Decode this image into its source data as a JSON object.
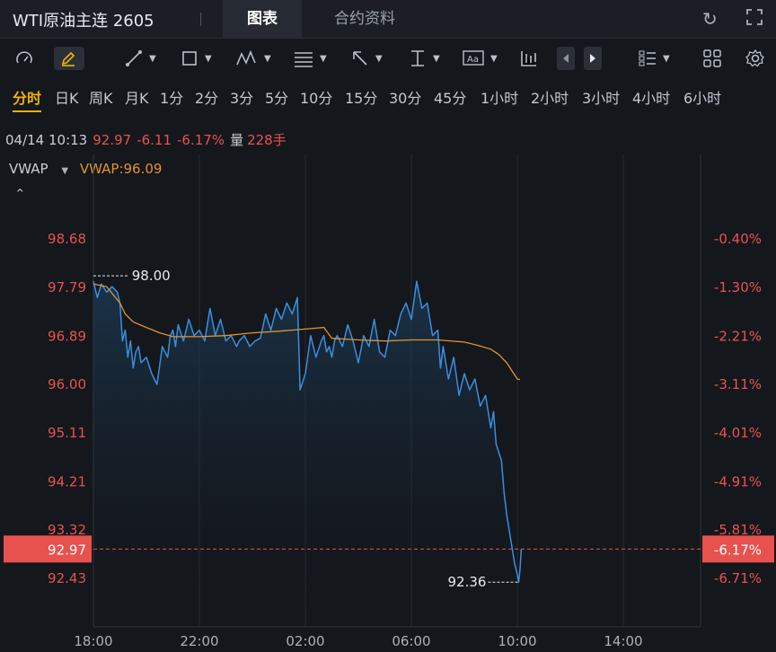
{
  "header": {
    "title": "WTI原油主连 2605",
    "tabs": [
      {
        "label": "图表",
        "active": true
      },
      {
        "label": "合约资料",
        "active": false
      }
    ],
    "icons": [
      "refresh-icon",
      "fullscreen-icon"
    ]
  },
  "toolbar": {
    "tools": [
      "gauge-icon",
      "pen-icon",
      "trendline-icon",
      "rectangle-icon",
      "wave-icon",
      "fib-icon",
      "arrow-icon",
      "measure-icon",
      "text-icon",
      "candles-icon",
      "prev-icon",
      "next-icon",
      "list-icon",
      "grid-icon",
      "settings-icon"
    ]
  },
  "periods": [
    "分时",
    "日K",
    "周K",
    "月K",
    "1分",
    "2分",
    "3分",
    "5分",
    "10分",
    "15分",
    "30分",
    "45分",
    "1小时",
    "2小时",
    "3小时",
    "4小时",
    "6小时"
  ],
  "info": {
    "datetime": "04/14 10:13",
    "price": "92.97",
    "change": "-6.11",
    "change_pct": "-6.17%",
    "volume_label": "量",
    "volume": "228手"
  },
  "indicator": {
    "name": "VWAP",
    "value_label": "VWAP:96.09"
  },
  "colors": {
    "up_red": "#e8524e",
    "line_blue": "#3b8ede",
    "vwap_orange": "#e3922c",
    "accent_yellow": "#f0b400",
    "bg": "#14171c"
  },
  "chart_data": {
    "type": "line",
    "y_ticks": [
      "98.68",
      "97.79",
      "96.89",
      "96.00",
      "95.11",
      "94.21",
      "93.32",
      "92.43"
    ],
    "y_tick_values": [
      98.68,
      97.79,
      96.89,
      96.0,
      95.11,
      94.21,
      93.32,
      92.43
    ],
    "pct_ticks": [
      "-0.40%",
      "-1.30%",
      "-2.21%",
      "-3.11%",
      "-4.01%",
      "-4.91%",
      "-5.81%",
      "-6.71%"
    ],
    "x_ticks": [
      "18:00",
      "22:00",
      "02:00",
      "06:00",
      "10:00",
      "14:00"
    ],
    "ylim": [
      92.0,
      99.3
    ],
    "current_price_label": "92.97",
    "current_price": 92.97,
    "current_pct_label": "-6.17%",
    "high_label": "98.00",
    "high": 98.0,
    "low_label": "92.36",
    "low": 92.36,
    "series": [
      {
        "name": "price",
        "x_hours": [
          0,
          0.15,
          0.3,
          0.5,
          0.7,
          0.9,
          1.0,
          1.1,
          1.2,
          1.3,
          1.4,
          1.5,
          1.6,
          1.7,
          1.8,
          2.0,
          2.2,
          2.4,
          2.6,
          2.8,
          2.9,
          3.0,
          3.1,
          3.2,
          3.4,
          3.6,
          3.8,
          4.0,
          4.2,
          4.4,
          4.6,
          4.8,
          5.0,
          5.2,
          5.3,
          5.4,
          5.5,
          5.7,
          5.9,
          6.1,
          6.3,
          6.5,
          6.7,
          6.9,
          7.1,
          7.3,
          7.5,
          7.7,
          7.8,
          8.0,
          8.2,
          8.4,
          8.6,
          8.7,
          8.8,
          8.9,
          9.0,
          9.1,
          9.2,
          9.4,
          9.6,
          9.8,
          10.0,
          10.2,
          10.4,
          10.6,
          10.8,
          11.0,
          11.2,
          11.4,
          11.6,
          11.8,
          12.0,
          12.2,
          12.4,
          12.6,
          12.8,
          13.0,
          13.1,
          13.2,
          13.4,
          13.6,
          13.8,
          14.0,
          14.2,
          14.4,
          14.6,
          14.8,
          15.0,
          15.1,
          15.2,
          15.4,
          15.5,
          15.6,
          15.7,
          15.8,
          15.9,
          16.0,
          16.05,
          16.1,
          16.15
        ],
        "values": [
          97.9,
          97.6,
          97.85,
          97.7,
          97.8,
          97.7,
          97.5,
          96.8,
          97.0,
          96.5,
          96.8,
          96.3,
          96.6,
          96.7,
          96.4,
          96.5,
          96.2,
          96.0,
          96.7,
          96.5,
          96.9,
          97.0,
          96.7,
          97.1,
          96.8,
          97.2,
          96.9,
          97.0,
          96.8,
          97.4,
          96.9,
          97.2,
          96.8,
          96.9,
          96.8,
          96.7,
          96.8,
          96.9,
          96.7,
          96.8,
          96.85,
          97.3,
          97.0,
          97.4,
          97.2,
          97.5,
          97.3,
          97.6,
          95.9,
          96.2,
          96.9,
          96.5,
          96.8,
          96.9,
          96.6,
          96.7,
          96.5,
          96.8,
          96.9,
          96.7,
          97.1,
          96.8,
          96.4,
          96.9,
          96.7,
          97.2,
          96.6,
          96.5,
          97.0,
          96.9,
          97.3,
          97.5,
          97.2,
          97.9,
          97.4,
          97.5,
          96.9,
          97.0,
          96.3,
          96.7,
          96.1,
          96.5,
          95.8,
          96.2,
          95.9,
          96.1,
          95.6,
          95.8,
          95.2,
          95.5,
          94.9,
          94.6,
          94.0,
          93.6,
          93.3,
          93.0,
          92.7,
          92.5,
          92.36,
          92.6,
          92.97
        ]
      },
      {
        "name": "VWAP",
        "x_hours": [
          0,
          0.5,
          1.0,
          1.2,
          1.5,
          2.0,
          2.5,
          3.0,
          4.0,
          5.0,
          6.0,
          7.0,
          8.0,
          8.7,
          9.0,
          10.0,
          11.0,
          12.0,
          13.0,
          14.0,
          14.5,
          15.0,
          15.3,
          15.6,
          15.8,
          16.0,
          16.1
        ],
        "values": [
          97.85,
          97.8,
          97.5,
          97.3,
          97.15,
          97.05,
          96.95,
          96.88,
          96.88,
          96.9,
          96.95,
          96.98,
          97.02,
          97.05,
          96.85,
          96.82,
          96.8,
          96.82,
          96.82,
          96.78,
          96.72,
          96.65,
          96.55,
          96.4,
          96.25,
          96.1,
          96.09
        ]
      }
    ],
    "grid": true
  }
}
